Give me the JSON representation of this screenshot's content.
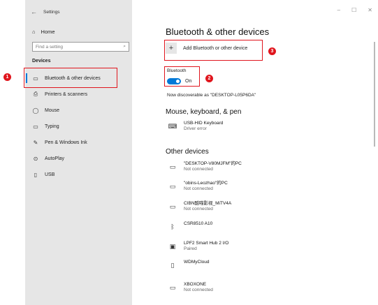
{
  "window": {
    "title": "Settings",
    "controls": {
      "minimize": "–",
      "maximize": "☐",
      "close": "✕"
    }
  },
  "sidebar": {
    "home_label": "Home",
    "search_placeholder": "Find a setting",
    "section_label": "Devices",
    "items": [
      {
        "label": "Bluetooth & other devices",
        "icon": "bluetooth-devices-icon",
        "active": true
      },
      {
        "label": "Printers & scanners",
        "icon": "printer-icon"
      },
      {
        "label": "Mouse",
        "icon": "mouse-icon"
      },
      {
        "label": "Typing",
        "icon": "keyboard-icon"
      },
      {
        "label": "Pen & Windows Ink",
        "icon": "pen-icon"
      },
      {
        "label": "AutoPlay",
        "icon": "autoplay-icon"
      },
      {
        "label": "USB",
        "icon": "usb-icon"
      }
    ]
  },
  "main": {
    "title": "Bluetooth & other devices",
    "add_label": "Add Bluetooth or other device",
    "bluetooth_label": "Bluetooth",
    "toggle_state": "On",
    "discoverable_text": "Now discoverable as \"DESKTOP-L05P6DA\"",
    "mouse_group_title": "Mouse, keyboard, & pen",
    "mouse_devices": [
      {
        "name": "USB-HID Keyboard",
        "status": "Driver error",
        "icon": "keyboard-icon"
      }
    ],
    "other_group_title": "Other devices",
    "other_devices": [
      {
        "name": "\"DESKTOP-V80MJFM\"的PC",
        "status": "Not connected",
        "icon": "pc-icon"
      },
      {
        "name": "\"obins-Leozhao\"的PC",
        "status": "Not connected",
        "icon": "pc-icon"
      },
      {
        "name": "CIBN酷喵影视_MiTV4A",
        "status": "Not connected",
        "icon": "pc-icon"
      },
      {
        "name": "CSR8510 A10",
        "status": "",
        "icon": "bluetooth-icon"
      },
      {
        "name": "LPF2 Smart Hub 2 I/O",
        "status": "Paired",
        "icon": "hub-icon"
      },
      {
        "name": "WDMyCloud",
        "status": "",
        "icon": "storage-icon"
      },
      {
        "name": "XBOXONE",
        "status": "Not connected",
        "icon": "console-icon"
      }
    ]
  },
  "annotations": [
    {
      "number": "1",
      "target": "sidebar-item-bluetooth"
    },
    {
      "number": "2",
      "target": "bluetooth-toggle"
    },
    {
      "number": "3",
      "target": "add-device-button"
    }
  ],
  "colors": {
    "accent": "#0078d7",
    "callout": "#e0151d",
    "sidebar_bg": "#e6e6e6"
  }
}
